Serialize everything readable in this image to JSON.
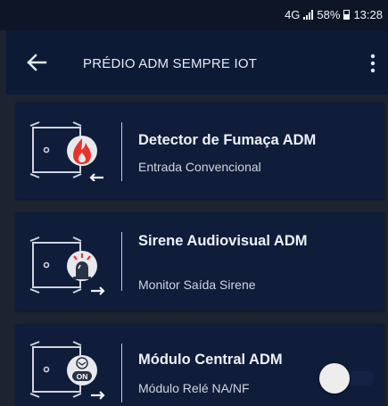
{
  "status_bar": {
    "network": "4G",
    "battery": "58%",
    "time": "13:28",
    "signal_icon": "signal-bars-icon",
    "battery_icon": "battery-icon"
  },
  "app_bar": {
    "title": "PRÉDIO ADM SEMPRE IOT",
    "back_icon": "arrow-left-icon",
    "menu_icon": "more-vertical-icon"
  },
  "devices": [
    {
      "title": "Detector de Fumaça ADM",
      "subtitle": "Entrada Convencional",
      "icon": "smoke-detector-input-icon"
    },
    {
      "title": "Sirene Audiovisual ADM",
      "subtitle": "Monitor Saída Sirene",
      "icon": "siren-output-icon"
    },
    {
      "title": "Módulo Central ADM",
      "subtitle": "Módulo Relé NA/NF",
      "icon": "relay-module-on-icon",
      "badge": "ON",
      "switch_on": false
    }
  ],
  "colors": {
    "background": "#1d2331",
    "app_bar": "#0d1a36",
    "card": "#0f1c3a",
    "text": "#eef1f6",
    "flame_red": "#e8322c",
    "toggle_thumb": "#ededed"
  }
}
